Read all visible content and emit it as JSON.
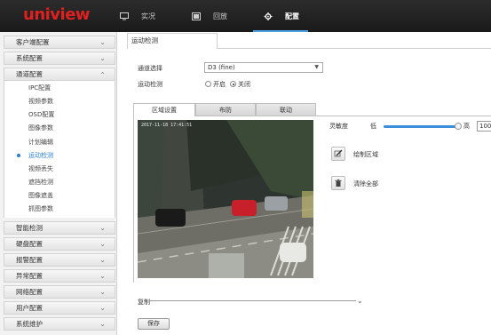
{
  "app": {
    "logo": "uniview",
    "nav": [
      {
        "label": "实况",
        "icon": "monitor-icon"
      },
      {
        "label": "回放",
        "icon": "film-icon"
      },
      {
        "label": "配置",
        "icon": "gear-icon"
      }
    ],
    "active_nav": "配置"
  },
  "sidebar": {
    "groups_top": [
      "客户端配置",
      "系统配置",
      "通道配置"
    ],
    "channel_items": [
      "IPC配置",
      "视频参数",
      "OSD配置",
      "图像参数",
      "计划编辑",
      "运动检测",
      "视频丢失",
      "遮挡检测",
      "图像遮盖",
      "抓图参数"
    ],
    "active_item": "运动检测",
    "groups_bottom": [
      "智能检测",
      "硬盘配置",
      "报警配置",
      "异常配置",
      "网络配置",
      "用户配置",
      "系统维护"
    ]
  },
  "page": {
    "tab_label": "运动检测",
    "channel_label": "通道选择",
    "channel_value": "D3 (fine)",
    "motion_label": "运动检测",
    "radio_on": "开启",
    "radio_off": "关闭",
    "radio_selected": "关闭",
    "subtabs": [
      "区域设置",
      "布防",
      "联动"
    ],
    "active_subtab": "区域设置",
    "video_timestamp": "2017-11-18 17:41:51",
    "sensitivity_label": "灵敏度",
    "low_label": "低",
    "high_label": "高",
    "sensitivity_value": "100",
    "sensitivity_level": 1.0,
    "draw_area_label": "绘制区域",
    "clear_all_label": "清除全部",
    "copy_label": "复制",
    "save_label": "保存"
  },
  "colors": {
    "topbar": "#1f1f1f",
    "logo": "#e02020",
    "accent": "#2a7fd4"
  }
}
